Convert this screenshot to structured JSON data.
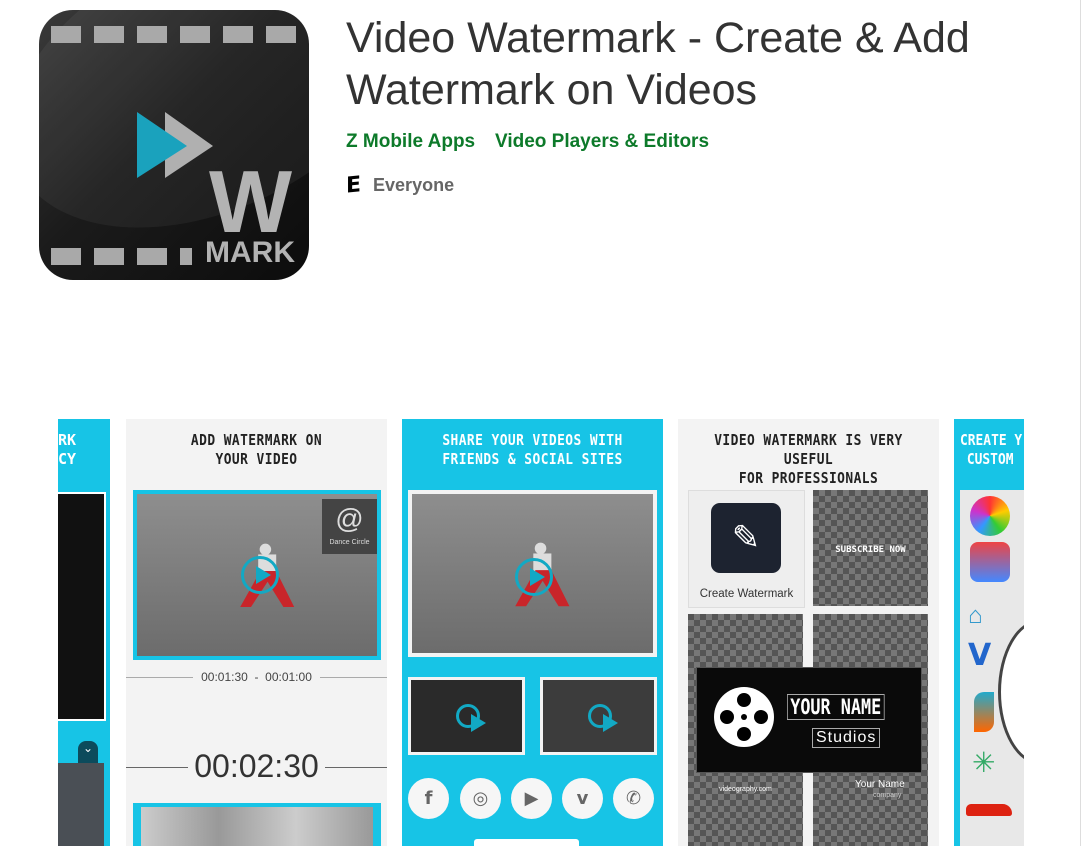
{
  "app": {
    "title": "Video Watermark - Create & Add Watermark on Videos",
    "developer": "Z Mobile Apps",
    "category": "Video Players & Editors",
    "content_rating": "Everyone",
    "content_rating_icon": "esrb-e-icon",
    "icon_text": {
      "letter": "W",
      "word": "MARK"
    }
  },
  "colors": {
    "link_green": "#0d7a2a",
    "screenshot_cyan": "#17c4e6",
    "accent_teal": "#12a9c4"
  },
  "screenshots": [
    {
      "title_lines": [
        "RK",
        "CY"
      ]
    },
    {
      "title_lines": [
        "ADD WATERMARK ON",
        "YOUR VIDEO"
      ],
      "watermark_label": "Dance Circle",
      "time_range": "00:01:30  -  00:01:00",
      "duration": "00:02:30"
    },
    {
      "title_lines": [
        "SHARE YOUR VIDEOS WITH",
        "FRIENDS & SOCIAL SITES"
      ],
      "social": [
        "facebook-icon",
        "instagram-icon",
        "youtube-icon",
        "vimeo-icon",
        "whatsapp-icon"
      ],
      "social_glyphs": [
        "f",
        "◎",
        "▶",
        "v",
        "✆"
      ]
    },
    {
      "title_lines": [
        "VIDEO WATERMARK IS VERY USEFUL",
        "FOR PROFESSIONALS"
      ],
      "create_label": "Create Watermark",
      "subscribe": "SUBSCRIBE NOW",
      "your_name": "YOUR NAME",
      "studios": "Studios",
      "videography": "videography.com",
      "company_name": "Your Name",
      "company": "company"
    },
    {
      "title_lines": [
        "CREATE Y",
        "CUSTOM"
      ]
    }
  ]
}
